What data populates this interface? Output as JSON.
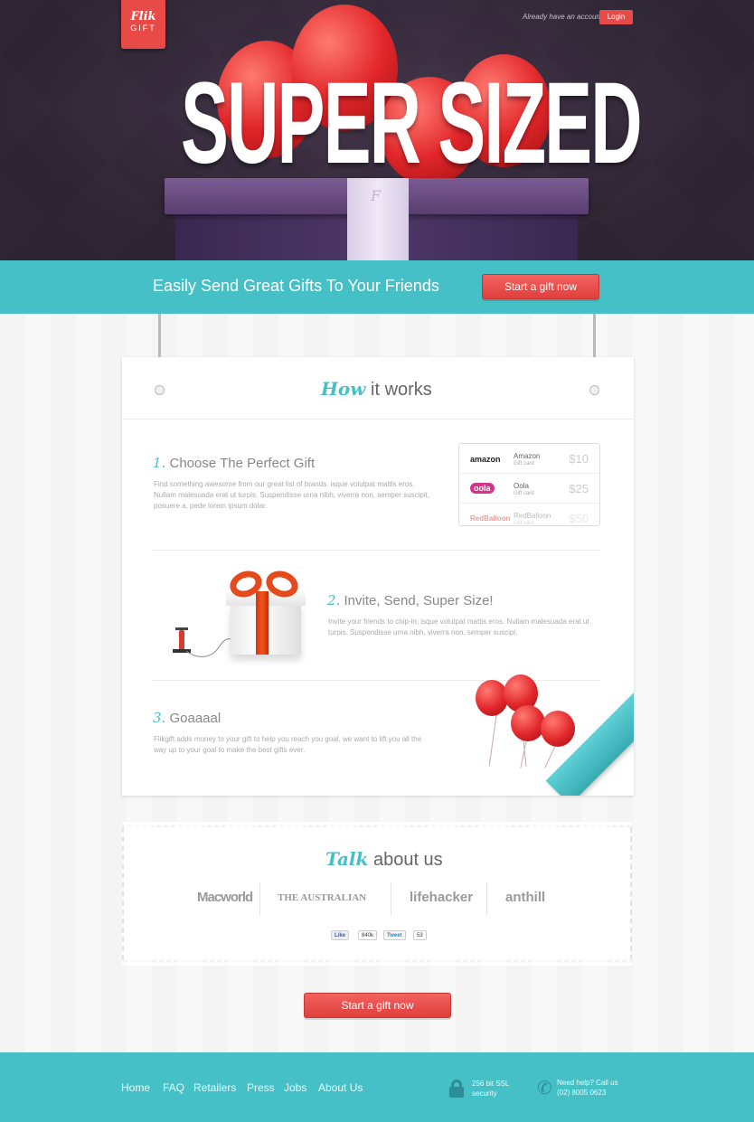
{
  "header": {
    "logo_line1": "Flik",
    "logo_line2": "GIFT",
    "login_prompt": "Already have an account?",
    "login_label": "Login"
  },
  "hero": {
    "title": "SUPER SIZED",
    "ribbon_mark": "F",
    "tagline": "Easily Send Great Gifts To Your Friends",
    "cta_label": "Start a gift now"
  },
  "how": {
    "title_accent": "How",
    "title_rest": " it works",
    "steps": [
      {
        "num": "1.",
        "title": " Choose The Perfect Gift",
        "text": "Find something awesome from our great list of brands. isque volutpat mattis eros. Nullam malesuada erat ut turpis. Suspendisse urna nibh, viverra non, semper suscipit, posuere a, pede lorem ipsum dolar."
      },
      {
        "num": "2.",
        "title": " Invite, Send, Super Size!",
        "text": "Invite your friends to chip-in, isque volutpat mattis eros. Nullam malesuada erat ut turpis. Suspendisse urna nibh, viverra non, semper suscipi."
      },
      {
        "num": "3.",
        "title": " Goaaaal",
        "text": "Flikgift adds money to your gift to help you reach you goal, we want to lift you all the way up to your goal to make the best gifts ever."
      }
    ],
    "giftcards": [
      {
        "logo": "amazon",
        "name": "Amazon",
        "sub": "Gift card",
        "price": "$10"
      },
      {
        "logo": "oola",
        "name": "Oola",
        "sub": "Gift card",
        "price": "$25"
      },
      {
        "logo": "RedBalloon",
        "name": "RedBalloon",
        "sub": "Gift card",
        "price": "$50"
      }
    ]
  },
  "talk": {
    "title_accent": "Talk",
    "title_rest": " about us",
    "press": [
      "Macworld",
      "THE AUSTRALIAN",
      "lifehacker",
      "anthill"
    ],
    "fb_like": "Like",
    "fb_count": "840k",
    "tweet": "Tweet",
    "tweet_count": "53"
  },
  "bottom_cta": "Start a gift now",
  "footer": {
    "nav": [
      "Home",
      "FAQ",
      "Retailers",
      "Press",
      "Jobs",
      "About Us"
    ],
    "ssl_line1": "256 bit SSL",
    "ssl_line2": "security",
    "help_line1": "Need help? Call us",
    "help_line2": "(02) 8005 0623"
  },
  "colors": {
    "teal": "#45c0c6",
    "red": "#e84a47",
    "hero_bg": "#3b3040"
  }
}
